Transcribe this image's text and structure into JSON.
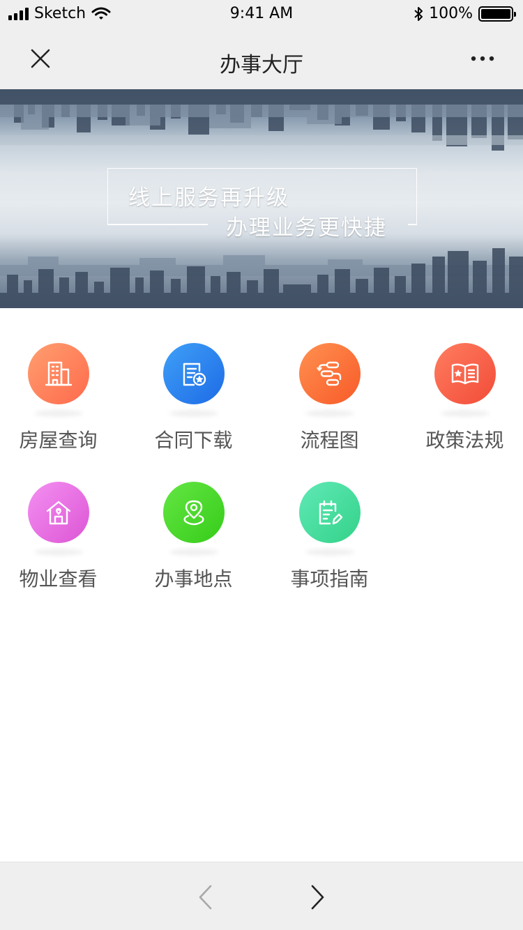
{
  "status_bar": {
    "carrier": "Sketch",
    "time": "9:41 AM",
    "battery_percent": "100%",
    "battery_level": 1.0
  },
  "nav": {
    "title": "办事大厅",
    "close_icon": "close-icon",
    "more_icon": "more-icon"
  },
  "banner": {
    "slogan_line1": "线上服务再升级",
    "slogan_line2": "办理业务更快捷"
  },
  "services": [
    {
      "label": "房屋查询",
      "icon": "building-icon",
      "color_from": "#ff9a6b",
      "color_to": "#ff6d4d"
    },
    {
      "label": "合同下载",
      "icon": "contract-icon",
      "color_from": "#3d9bf5",
      "color_to": "#1f6fe8"
    },
    {
      "label": "流程图",
      "icon": "flowchart-icon",
      "color_from": "#ff8c4a",
      "color_to": "#fa5c2b"
    },
    {
      "label": "政策法规",
      "icon": "policy-book-icon",
      "color_from": "#ff7a5c",
      "color_to": "#f4503a"
    },
    {
      "label": "物业查看",
      "icon": "house-icon",
      "color_from": "#f08bf0",
      "color_to": "#e05ad8"
    },
    {
      "label": "办事地点",
      "icon": "location-icon",
      "color_from": "#5ee33d",
      "color_to": "#3bd11f"
    },
    {
      "label": "事项指南",
      "icon": "guide-icon",
      "color_from": "#5ce6b0",
      "color_to": "#37d68c"
    }
  ],
  "toolbar": {
    "back_icon": "chevron-left-icon",
    "forward_icon": "chevron-right-icon"
  }
}
